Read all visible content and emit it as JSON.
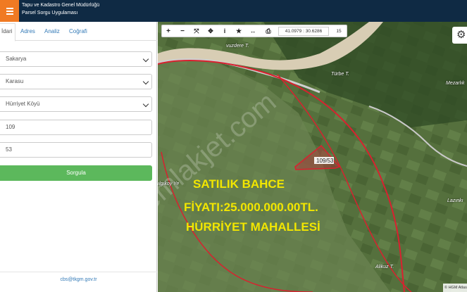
{
  "header": {
    "title_line1": "Tapu ve Kadastro Genel Müdürlüğü",
    "title_line2": "Parsel Sorgu Uygulaması"
  },
  "tabs": [
    {
      "label": "İdari",
      "active": true
    },
    {
      "label": "Adres",
      "active": false
    },
    {
      "label": "Analiz",
      "active": false
    },
    {
      "label": "Coğrafi",
      "active": false
    }
  ],
  "form": {
    "il": "Sakarya",
    "ilce": "Karasu",
    "mahalle": "Hürriyet Köyü",
    "ada": "109",
    "parsel": "53",
    "submit_label": "Sorgula"
  },
  "footer": {
    "email": "cbs@tkgm.gov.tr"
  },
  "toolbar": {
    "coordinates": "41.0979 : 30.6286",
    "zoom_level": "15"
  },
  "map": {
    "parcel_label": "109/53",
    "watermark": "emlakjet.com",
    "ad_line1": "SATILIK BAHCE",
    "ad_line2": "FİYATI:25.000.000.00TL.",
    "ad_line3": "HÜRRİYET MAHALLESİ",
    "places": {
      "vuzdere": "vuzdere T.",
      "turbe": "Türbe T.",
      "mezarlik": "Mezarlık",
      "lazinkiri": "Lazınkı",
      "alikuz": "Alikuz T.",
      "ilgikoy": "ılgıkoy Ye"
    },
    "copyright": "© HGM Atlas"
  }
}
